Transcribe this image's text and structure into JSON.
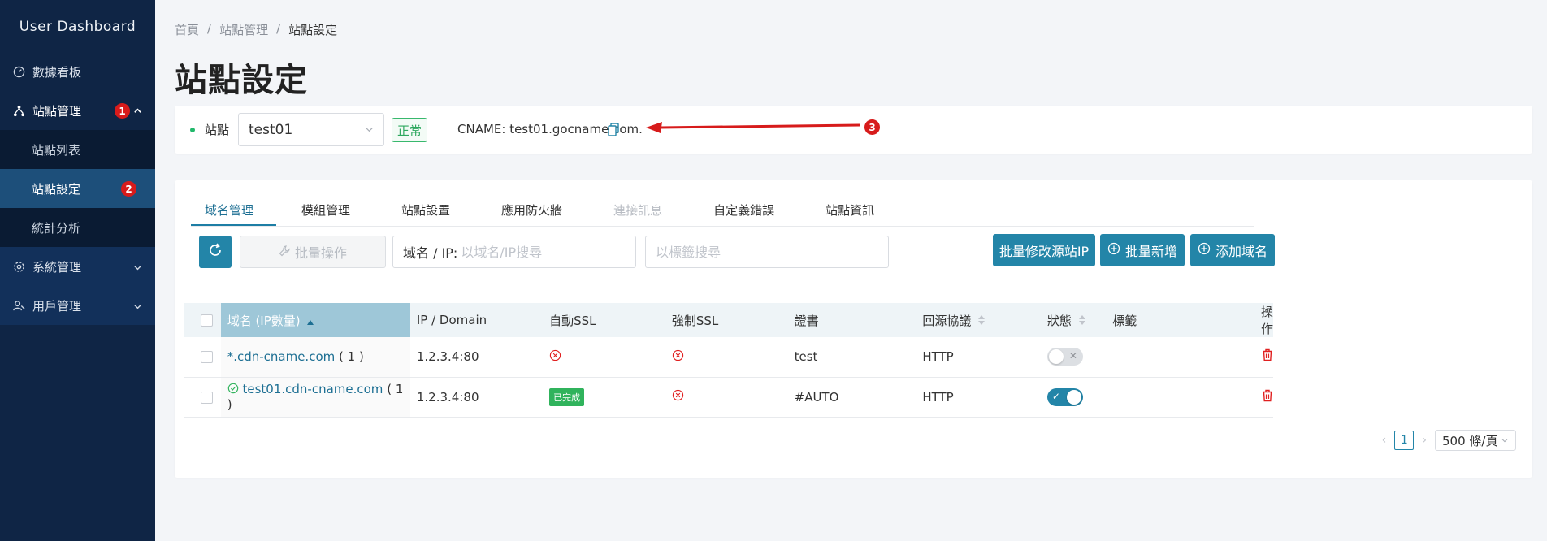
{
  "sidebar": {
    "title": "User Dashboard",
    "items": [
      {
        "label": "數據看板",
        "icon": "dashboard-icon"
      },
      {
        "label": "站點管理",
        "icon": "sitemap-icon",
        "badge": "1"
      },
      {
        "label": "系統管理",
        "icon": "gear-icon"
      },
      {
        "label": "用戶管理",
        "icon": "user-icon"
      }
    ],
    "subitems": [
      {
        "label": "站點列表"
      },
      {
        "label": "站點設定",
        "badge": "2"
      },
      {
        "label": "統計分析"
      }
    ]
  },
  "breadcrumb": {
    "home": "首頁",
    "sep": "/",
    "section": "站點管理",
    "current": "站點設定"
  },
  "page_title": "站點設定",
  "site_bar": {
    "label": "站點",
    "selected_site": "test01",
    "status": "正常",
    "cname": "CNAME: test01.gocname.com.",
    "annotation": "3"
  },
  "tabs": [
    {
      "label": "域名管理"
    },
    {
      "label": "模組管理"
    },
    {
      "label": "站點設置"
    },
    {
      "label": "應用防火牆"
    },
    {
      "label": "連接訊息"
    },
    {
      "label": "自定義錯誤"
    },
    {
      "label": "站點資訊"
    }
  ],
  "toolbar": {
    "batch_op_label": "批量操作",
    "domain_prefix": "域名 / IP:",
    "domain_placeholder": "以域名/IP搜尋",
    "tag_placeholder": "以標籤搜尋",
    "batch_edit_ip_label": "批量修改源站IP",
    "batch_add_label": "批量新增",
    "add_domain_label": "添加域名"
  },
  "table": {
    "headers": [
      "域名 (IP數量)",
      "IP / Domain",
      "自動SSL",
      "強制SSL",
      "證書",
      "回源協議",
      "狀態",
      "標籤",
      "操作"
    ],
    "rows": [
      {
        "domain": "*.cdn-cname.com",
        "count": "( 1 )",
        "ip": "1.2.3.4:80",
        "auto_ssl": "error",
        "force_ssl": "error",
        "cert": "test",
        "protocol": "HTTP",
        "enabled": false,
        "tag": ""
      },
      {
        "domain": "test01.cdn-cname.com",
        "count": "( 1 )",
        "ip": "1.2.3.4:80",
        "auto_ssl": "done",
        "auto_ssl_label": "已完成",
        "force_ssl": "error",
        "cert": "#AUTO",
        "protocol": "HTTP",
        "enabled": true,
        "tag": ""
      }
    ]
  },
  "pagination": {
    "current": "1",
    "page_size": "500 條/頁"
  },
  "colors": {
    "sidebar_bg": "#0f2545",
    "primary": "#2385a8",
    "danger": "#e02020",
    "success": "#30b35c"
  }
}
